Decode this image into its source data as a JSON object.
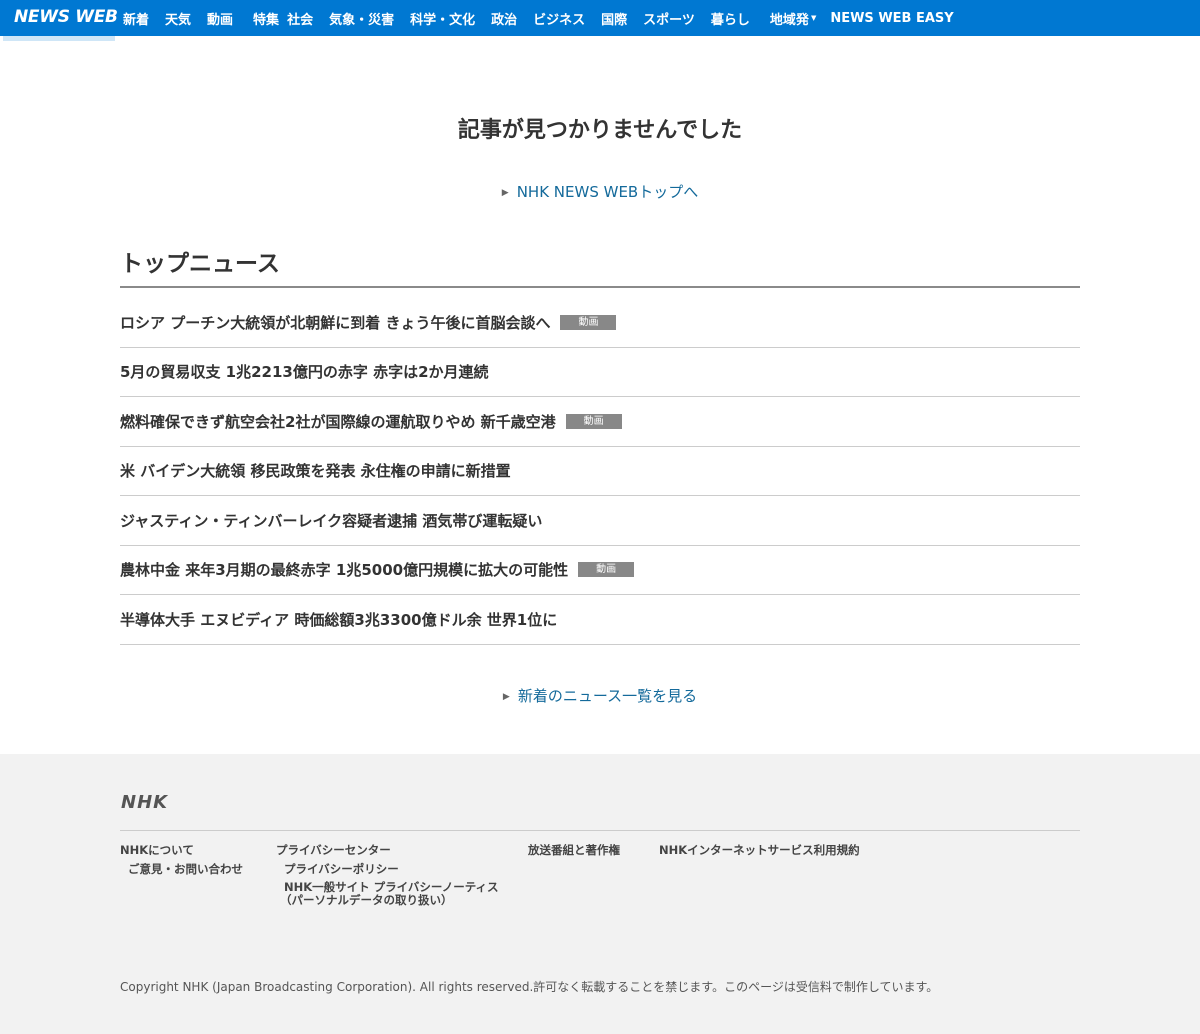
{
  "header": {
    "logo": "NEWS WEB",
    "nav": [
      "新着",
      "天気",
      "動画",
      "特集",
      "社会",
      "気象・災害",
      "科学・文化",
      "政治",
      "ビジネス",
      "国際",
      "スポーツ",
      "暮らし",
      "地域発",
      "NEWS WEB EASY"
    ]
  },
  "main": {
    "not_found_message": "記事が見つかりませんでした",
    "top_link": "NHK NEWS WEBトップへ",
    "section_title": "トップニュース",
    "video_badge_label": "動画",
    "news": [
      {
        "title": "ロシア プーチン大統領が北朝鮮に到着 きょう午後に首脳会談へ",
        "has_video": true
      },
      {
        "title": "5月の貿易収支 1兆2213億円の赤字 赤字は2か月連続",
        "has_video": false
      },
      {
        "title": "燃料確保できず航空会社2社が国際線の運航取りやめ 新千歳空港",
        "has_video": true
      },
      {
        "title": "米 バイデン大統領 移民政策を発表 永住権の申請に新措置",
        "has_video": false
      },
      {
        "title": "ジャスティン・ティンバーレイク容疑者逮捕 酒気帯び運転疑い",
        "has_video": false
      },
      {
        "title": "農林中金 来年3月期の最終赤字 1兆5000億円規模に拡大の可能性",
        "has_video": true
      },
      {
        "title": "半導体大手 エヌビディア 時価総額3兆3300億ドル余 世界1位に",
        "has_video": false
      }
    ],
    "more_link": "新着のニュース一覧を見る"
  },
  "footer": {
    "logo": "NHK",
    "links": {
      "about": "NHKについて",
      "feedback": "ご意見・お問い合わせ",
      "privacy_center": "プライバシーセンター",
      "privacy_policy": "プライバシーポリシー",
      "privacy_notice_line1": "NHK一般サイト プライバシーノーティス",
      "privacy_notice_line2": "（パーソナルデータの取り扱い）",
      "copyright_programs": "放送番組と著作権",
      "terms": "NHKインターネットサービス利用規約"
    },
    "copyright": "Copyright NHK (Japan Broadcasting Corporation). All rights reserved.許可なく転載することを禁じます。このページは受信料で制作しています。"
  }
}
